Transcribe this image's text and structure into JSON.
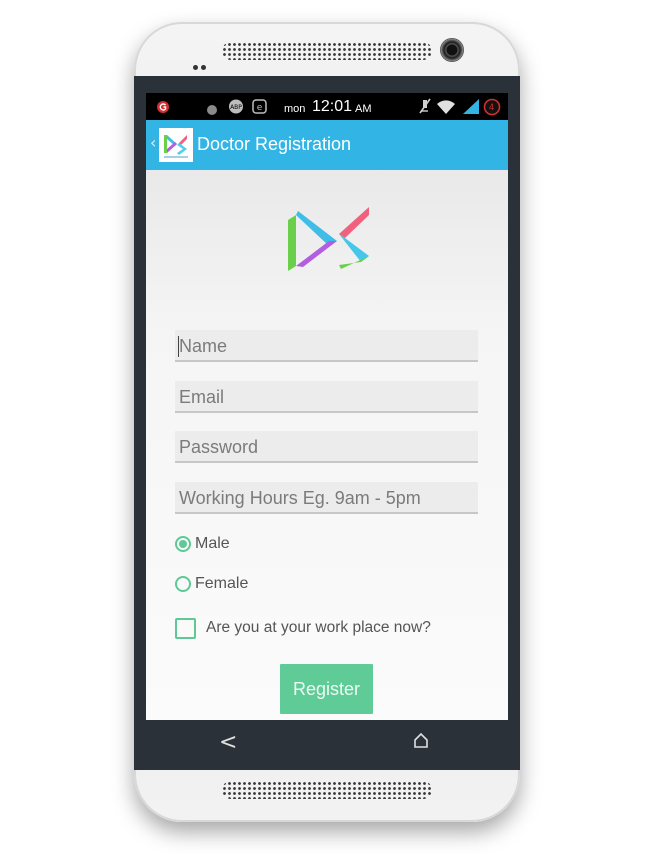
{
  "status_bar": {
    "day": "mon",
    "time": "12:01",
    "ampm": "AM",
    "notification_count": "4",
    "icons": [
      "app-notification-icon",
      "record-icon",
      "adb-icon",
      "e-icon",
      "mute-icon",
      "wifi-icon",
      "signal-icon",
      "battery-icon"
    ]
  },
  "action_bar": {
    "title": "Doctor Registration",
    "up_icon": "chevron-left-icon",
    "app_icon": "ds-logo-icon"
  },
  "form": {
    "name_placeholder": "Name",
    "email_placeholder": "Email",
    "password_placeholder": "Password",
    "hours_placeholder": "Working Hours Eg. 9am - 5pm",
    "gender_options": [
      {
        "label": "Male",
        "selected": true
      },
      {
        "label": "Female",
        "selected": false
      }
    ],
    "workplace_label": "Are you at your work place now?",
    "workplace_checked": false,
    "register_label": "Register"
  },
  "nav_bar": {
    "icons": [
      "back-icon",
      "home-icon"
    ]
  },
  "colors": {
    "accent": "#32b5e5",
    "green": "#5ec896",
    "status_bar": "#000000"
  }
}
